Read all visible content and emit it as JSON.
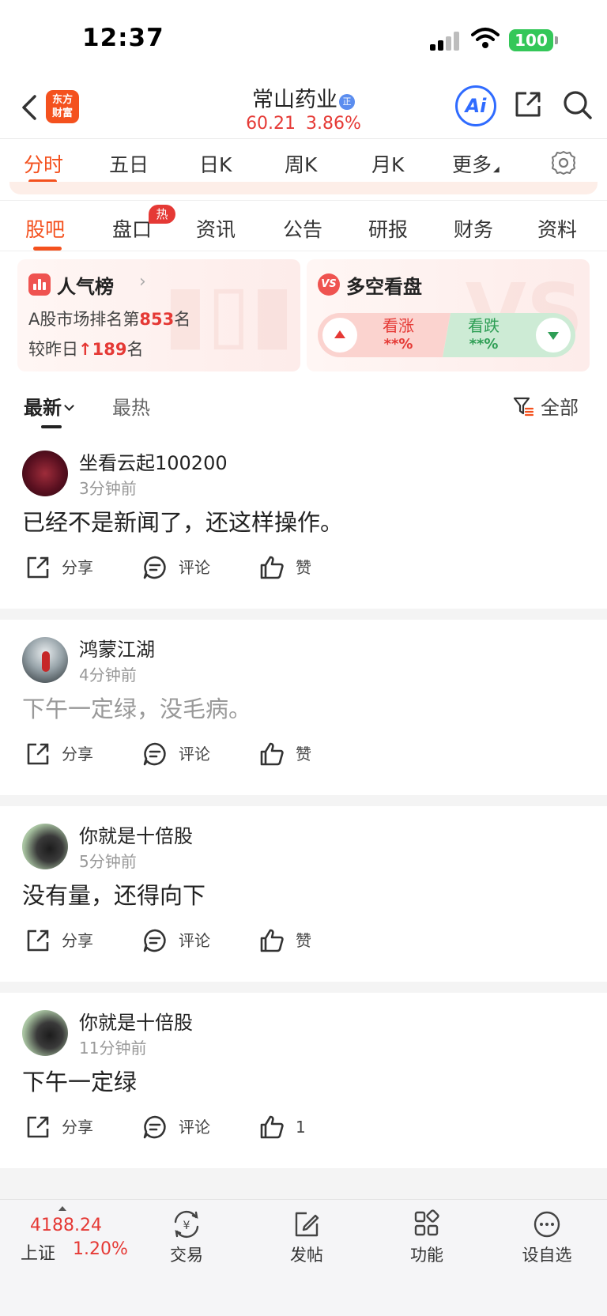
{
  "status_bar": {
    "time": "12:37",
    "battery": "100"
  },
  "header": {
    "logo_line1": "东方",
    "logo_line2": "财富",
    "stock_name": "常山药业",
    "badge": "正",
    "price": "60.21",
    "change_pct": "3.86%",
    "ai_label": "Ai",
    "price_color": "#e53935"
  },
  "chart_tabs": [
    "分时",
    "五日",
    "日K",
    "周K",
    "月K",
    "更多"
  ],
  "section_tabs": [
    "股吧",
    "盘口",
    "资讯",
    "公告",
    "研报",
    "财务",
    "资料"
  ],
  "hot_badge": "热",
  "popularity_card": {
    "title": "人气榜",
    "rank_prefix": "A股市场排名第",
    "rank": "853",
    "rank_suffix": "名",
    "change_prefix": "较昨日",
    "change_arrow": "↑",
    "change": "189",
    "change_suffix": "名"
  },
  "bullbear_card": {
    "title": "多空看盘",
    "vs_label": "VS",
    "bull_label": "看涨",
    "bull_pct": "**%",
    "bear_label": "看跌",
    "bear_pct": "**%",
    "bull_color": "#e53935",
    "bear_color": "#2e9e55"
  },
  "sort_bar": {
    "latest": "最新",
    "hot": "最热",
    "filter": "全部"
  },
  "posts": [
    {
      "username": "坐看云起100200",
      "time": "3分钟前",
      "content": "已经不是新闻了，还这样操作。",
      "share": "分享",
      "comment": "评论",
      "like": "赞"
    },
    {
      "username": "鸿蒙江湖",
      "time": "4分钟前",
      "content": "下午一定绿，没毛病。",
      "share": "分享",
      "comment": "评论",
      "like": "赞"
    },
    {
      "username": "你就是十倍股",
      "time": "5分钟前",
      "content": "没有量，还得向下",
      "share": "分享",
      "comment": "评论",
      "like": "赞"
    },
    {
      "username": "你就是十倍股",
      "time": "11分钟前",
      "content": "下午一定绿",
      "share": "分享",
      "comment": "评论",
      "like": "1"
    }
  ],
  "bottom_nav": {
    "index_value": "4188.24",
    "index_name": "上证",
    "index_pct": "1.20%",
    "items": [
      "交易",
      "发帖",
      "功能",
      "设自选"
    ]
  }
}
